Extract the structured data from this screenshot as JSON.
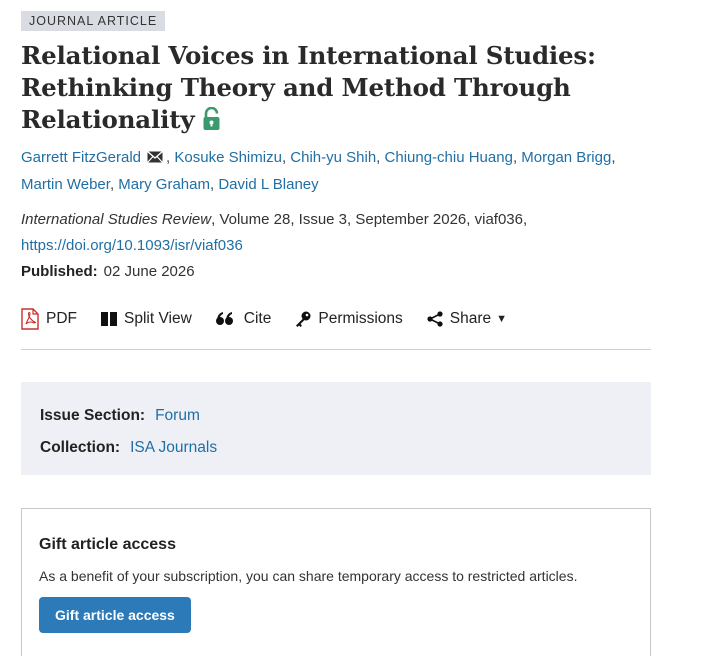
{
  "article": {
    "type_badge": "JOURNAL ARTICLE",
    "title": "Relational Voices in International Studies: Rethinking Theory and Method Through Relationality",
    "access_icon": "open-lock-icon",
    "authors": [
      "Garrett FitzGerald",
      "Kosuke Shimizu",
      "Chih-yu Shih",
      "Chiung-chiu Huang",
      "Morgan Brigg",
      "Martin Weber",
      "Mary Graham",
      "David L Blaney"
    ],
    "citation": {
      "journal": "International Studies Review",
      "details": ", Volume 28, Issue 3, September 2026, viaf036,",
      "doi": "https://doi.org/10.1093/isr/viaf036"
    },
    "published": {
      "label": "Published:",
      "date": "02 June 2026"
    }
  },
  "toolbar": {
    "pdf": "PDF",
    "split_view": "Split View",
    "cite": "Cite",
    "permissions": "Permissions",
    "share": "Share"
  },
  "issue_info": {
    "section_label": "Issue Section:",
    "section_value": "Forum",
    "collection_label": "Collection:",
    "collection_value": "ISA Journals"
  },
  "gift": {
    "title": "Gift article access",
    "text": "As a benefit of your subscription, you can share temporary access to restricted articles.",
    "button": "Gift article access"
  },
  "colors": {
    "link": "#1f6fa5",
    "badge_bg": "#d9dce3",
    "open_access": "#3a9a6e",
    "pdf_red": "#c9302c",
    "button_bg": "#2c7ab8",
    "info_bg": "#eef0f5"
  }
}
